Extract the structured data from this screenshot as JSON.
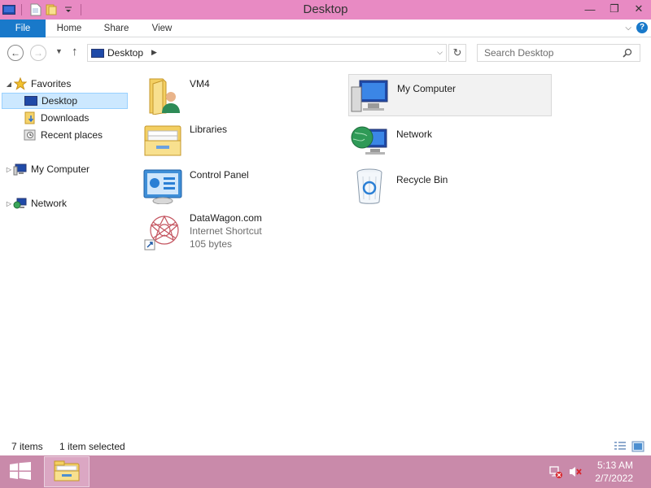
{
  "window": {
    "title": "Desktop",
    "controls": {
      "minimize": "—",
      "restore": "❐",
      "close": "✕"
    }
  },
  "ribbon": {
    "tabs": [
      "File",
      "Home",
      "Share",
      "View"
    ],
    "accent": "#1979ca"
  },
  "address": {
    "crumb": "Desktop",
    "search_placeholder": "Search Desktop"
  },
  "nav_pane": {
    "favorites": "Favorites",
    "items": [
      "Desktop",
      "Downloads",
      "Recent places"
    ],
    "selected": "Desktop",
    "my_computer": "My Computer",
    "network": "Network"
  },
  "content": {
    "items": [
      {
        "name": "VM4",
        "icon": "user-folder-icon"
      },
      {
        "name": "Libraries",
        "icon": "libraries-icon"
      },
      {
        "name": "Control Panel",
        "icon": "control-panel-icon"
      },
      {
        "name": "DataWagon.com",
        "type": "Internet Shortcut",
        "size": "105 bytes",
        "icon": "internet-shortcut-icon"
      },
      {
        "name": "My Computer",
        "icon": "computer-icon",
        "selected": true
      },
      {
        "name": "Network",
        "icon": "network-icon"
      },
      {
        "name": "Recycle Bin",
        "icon": "recycle-bin-icon"
      }
    ]
  },
  "status": {
    "count": "7 items",
    "selection": "1 item selected"
  },
  "taskbar": {
    "time": "5:13 AM",
    "date": "2/7/2022",
    "color": "#c98aaa"
  },
  "titlebar_color": "#e88ac3"
}
